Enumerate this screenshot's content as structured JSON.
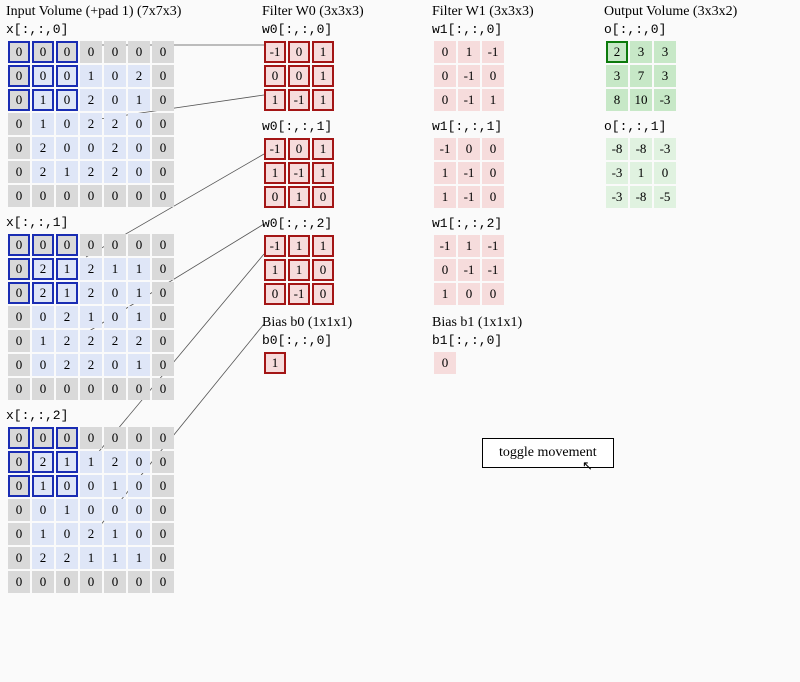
{
  "input": {
    "heading": "Input Volume (+pad 1) (7x7x3)",
    "slices": [
      {
        "label": "x[:,:,0]",
        "data": [
          [
            0,
            0,
            0,
            0,
            0,
            0,
            0
          ],
          [
            0,
            0,
            0,
            1,
            0,
            2,
            0
          ],
          [
            0,
            1,
            0,
            2,
            0,
            1,
            0
          ],
          [
            0,
            1,
            0,
            2,
            2,
            0,
            0
          ],
          [
            0,
            2,
            0,
            0,
            2,
            0,
            0
          ],
          [
            0,
            2,
            1,
            2,
            2,
            0,
            0
          ],
          [
            0,
            0,
            0,
            0,
            0,
            0,
            0
          ]
        ]
      },
      {
        "label": "x[:,:,1]",
        "data": [
          [
            0,
            0,
            0,
            0,
            0,
            0,
            0
          ],
          [
            0,
            2,
            1,
            2,
            1,
            1,
            0
          ],
          [
            0,
            2,
            1,
            2,
            0,
            1,
            0
          ],
          [
            0,
            0,
            2,
            1,
            0,
            1,
            0
          ],
          [
            0,
            1,
            2,
            2,
            2,
            2,
            0
          ],
          [
            0,
            0,
            2,
            2,
            0,
            1,
            0
          ],
          [
            0,
            0,
            0,
            0,
            0,
            0,
            0
          ]
        ]
      },
      {
        "label": "x[:,:,2]",
        "data": [
          [
            0,
            0,
            0,
            0,
            0,
            0,
            0
          ],
          [
            0,
            2,
            1,
            1,
            2,
            0,
            0
          ],
          [
            0,
            1,
            0,
            0,
            1,
            0,
            0
          ],
          [
            0,
            0,
            1,
            0,
            0,
            0,
            0
          ],
          [
            0,
            1,
            0,
            2,
            1,
            0,
            0
          ],
          [
            0,
            2,
            2,
            1,
            1,
            1,
            0
          ],
          [
            0,
            0,
            0,
            0,
            0,
            0,
            0
          ]
        ]
      }
    ]
  },
  "w0": {
    "heading": "Filter W0 (3x3x3)",
    "slices": [
      {
        "label": "w0[:,:,0]",
        "data": [
          [
            -1,
            0,
            1
          ],
          [
            0,
            0,
            1
          ],
          [
            1,
            -1,
            1
          ]
        ]
      },
      {
        "label": "w0[:,:,1]",
        "data": [
          [
            -1,
            0,
            1
          ],
          [
            1,
            -1,
            1
          ],
          [
            0,
            1,
            0
          ]
        ]
      },
      {
        "label": "w0[:,:,2]",
        "data": [
          [
            -1,
            1,
            1
          ],
          [
            1,
            1,
            0
          ],
          [
            0,
            -1,
            0
          ]
        ]
      }
    ],
    "bias_heading": "Bias b0 (1x1x1)",
    "bias_label": "b0[:,:,0]",
    "bias": 1
  },
  "w1": {
    "heading": "Filter W1 (3x3x3)",
    "slices": [
      {
        "label": "w1[:,:,0]",
        "data": [
          [
            0,
            1,
            -1
          ],
          [
            0,
            -1,
            0
          ],
          [
            0,
            -1,
            1
          ]
        ]
      },
      {
        "label": "w1[:,:,1]",
        "data": [
          [
            -1,
            0,
            0
          ],
          [
            1,
            -1,
            0
          ],
          [
            1,
            -1,
            0
          ]
        ]
      },
      {
        "label": "w1[:,:,2]",
        "data": [
          [
            -1,
            1,
            -1
          ],
          [
            0,
            -1,
            -1
          ],
          [
            1,
            0,
            0
          ]
        ]
      }
    ],
    "bias_heading": "Bias b1 (1x1x1)",
    "bias_label": "b1[:,:,0]",
    "bias": 0
  },
  "output": {
    "heading": "Output Volume (3x3x2)",
    "slices": [
      {
        "label": "o[:,:,0]",
        "data": [
          [
            2,
            3,
            3
          ],
          [
            3,
            7,
            3
          ],
          [
            8,
            10,
            -3
          ]
        ]
      },
      {
        "label": "o[:,:,1]",
        "data": [
          [
            -8,
            -8,
            -3
          ],
          [
            -3,
            1,
            0
          ],
          [
            -3,
            -8,
            -5
          ]
        ]
      }
    ]
  },
  "button": "toggle movement"
}
